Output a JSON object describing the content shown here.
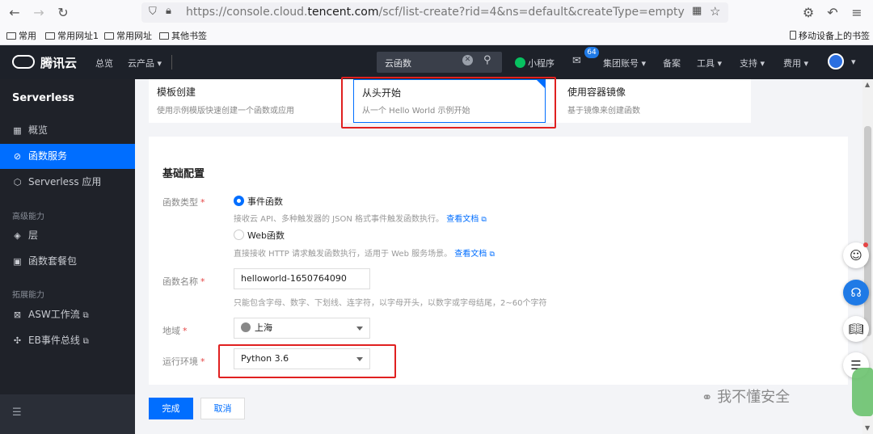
{
  "browser": {
    "url_prefix": "https://console.cloud.",
    "url_domain": "tencent.com",
    "url_suffix": "/scf/list-create?rid=4&ns=default&createType=empty",
    "bookmarks": [
      "常用",
      "常用网址1",
      "常用网址",
      "其他书签"
    ],
    "mobile_bookmarks": "移动设备上的书签"
  },
  "topnav": {
    "brand": "腾讯云",
    "overview": "总览",
    "products": "云产品",
    "search_value": "云函数",
    "miniprogram": "小程序",
    "message_count": "64",
    "group_account": "集团账号",
    "beian": "备案",
    "tools": "工具",
    "support": "支持",
    "billing": "费用"
  },
  "sidebar": {
    "title": "Serverless",
    "items": [
      {
        "label": "概览",
        "icon": "grid-icon"
      },
      {
        "label": "函数服务",
        "icon": "function-icon"
      },
      {
        "label": "Serverless 应用",
        "icon": "app-icon"
      }
    ],
    "group1": "高级能力",
    "items2": [
      {
        "label": "层",
        "icon": "layers-icon"
      },
      {
        "label": "函数套餐包",
        "icon": "package-icon"
      }
    ],
    "group2": "拓展能力",
    "items3": [
      {
        "label": "ASW工作流",
        "icon": "workflow-icon"
      },
      {
        "label": "EB事件总线",
        "icon": "eventbus-icon"
      }
    ]
  },
  "create_options": [
    {
      "title": "模板创建",
      "subtitle": "使用示例模版快速创建一个函数或应用"
    },
    {
      "title": "从头开始",
      "subtitle": "从一个 Hello World 示例开始"
    },
    {
      "title": "使用容器镜像",
      "subtitle": "基于镜像来创建函数"
    }
  ],
  "config": {
    "section_title": "基础配置",
    "function_type_label": "函数类型",
    "event_function": "事件函数",
    "event_hint": "接收云 API、多种触发器的 JSON 格式事件触发函数执行。",
    "web_function": "Web函数",
    "web_hint": "直接接收 HTTP 请求触发函数执行，适用于 Web 服务场景。",
    "docs_link": "查看文档",
    "name_label": "函数名称",
    "name_value": "helloworld-1650764090",
    "name_hint": "只能包含字母、数字、下划线、连字符，以字母开头，以数字或字母结尾，2~60个字符",
    "region_label": "地域",
    "region_value": "上海",
    "runtime_label": "运行环境",
    "runtime_value": "Python 3.6"
  },
  "actions": {
    "done": "完成",
    "cancel": "取消"
  },
  "watermark": "我不懂安全",
  "colors": {
    "accent": "#006eff",
    "highlight": "#e02020",
    "nav_bg": "#1d2129"
  }
}
